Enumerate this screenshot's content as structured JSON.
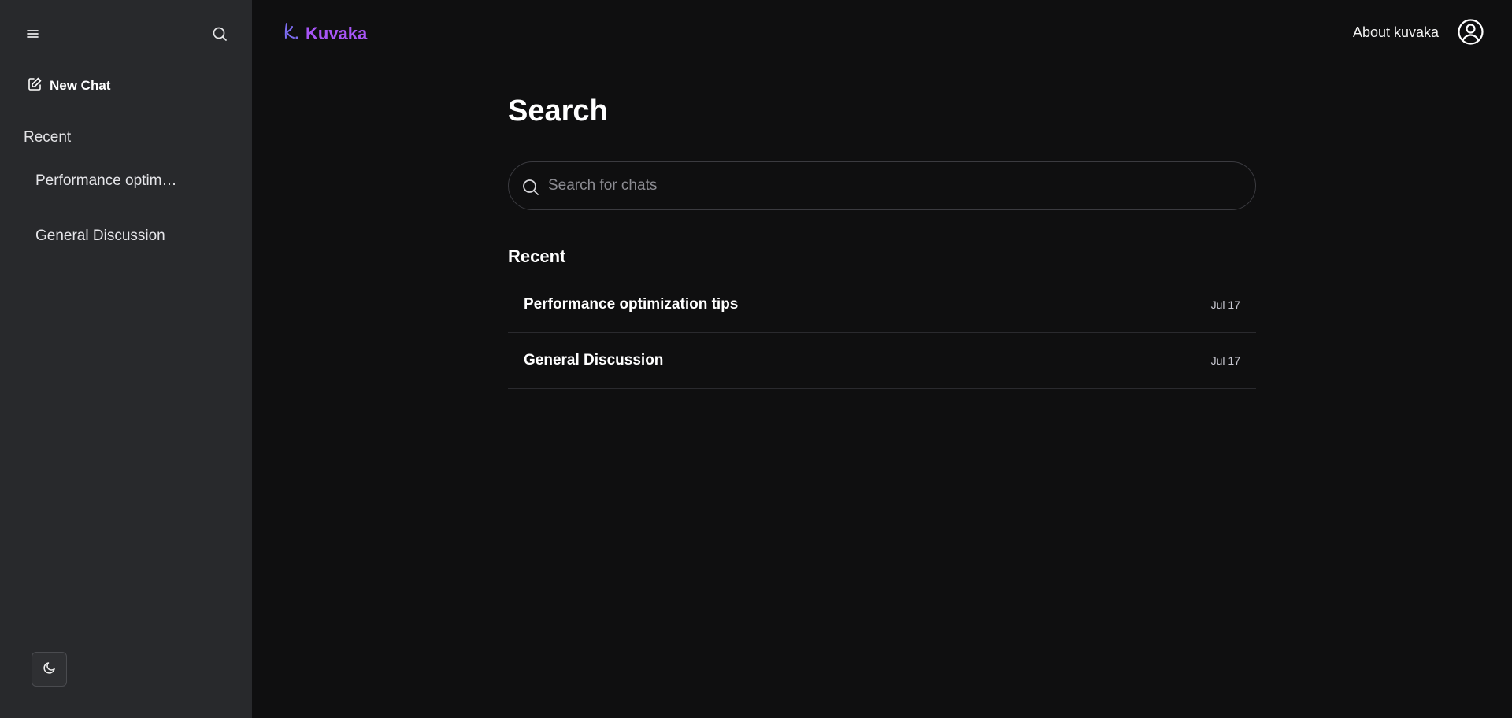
{
  "sidebar": {
    "new_chat_label": "New Chat",
    "recent_heading": "Recent",
    "items": [
      {
        "label": "Performance optimization tips"
      },
      {
        "label": "General Discussion"
      }
    ]
  },
  "header": {
    "brand": "Kuvaka",
    "about_label": "About kuvaka"
  },
  "main": {
    "title": "Search",
    "search": {
      "placeholder": "Search for chats",
      "value": ""
    },
    "recent_heading": "Recent",
    "results": [
      {
        "title": "Performance optimization tips",
        "date": "Jul 17"
      },
      {
        "title": "General Discussion",
        "date": "Jul 17"
      }
    ]
  },
  "colors": {
    "brand": "#a855f7",
    "sidebar_bg": "#28292c",
    "main_bg": "#0f0f10"
  },
  "icons": [
    "menu-icon",
    "search-icon",
    "edit-icon",
    "moon-icon",
    "logo-icon",
    "user-circle-icon"
  ]
}
